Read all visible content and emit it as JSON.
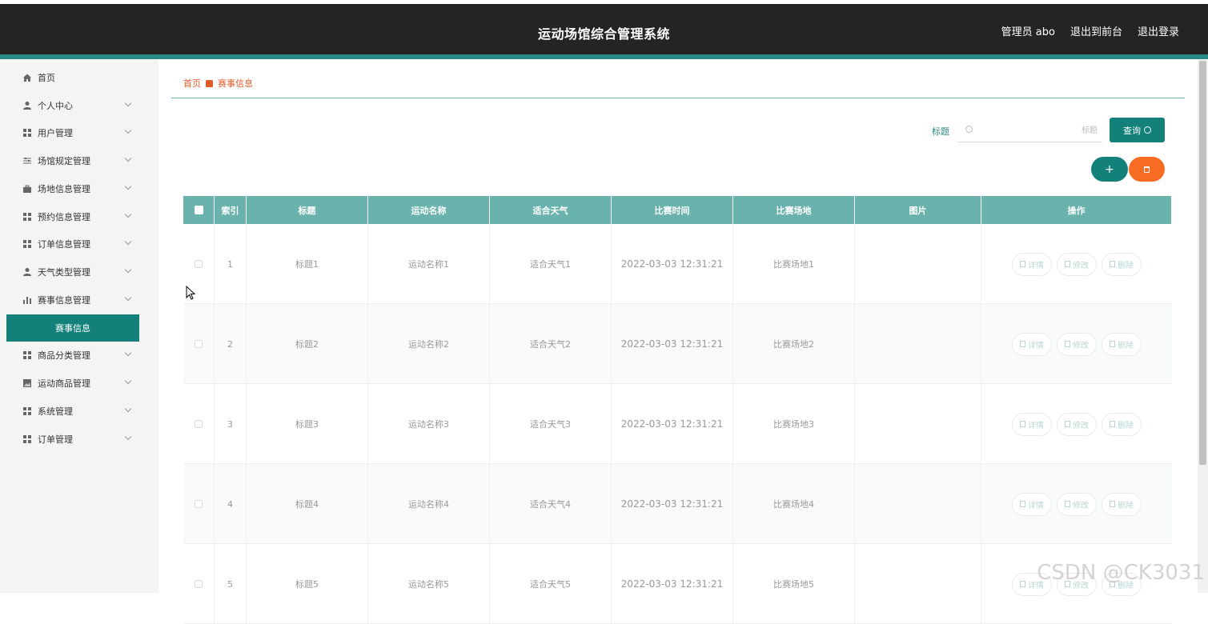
{
  "header": {
    "title": "运动场馆综合管理系统",
    "user": "管理员 abo",
    "to_front": "退出到前台",
    "logout": "退出登录"
  },
  "sidebar": {
    "items": [
      {
        "label": "首页",
        "icon": "home-icon"
      },
      {
        "label": "个人中心",
        "icon": "user-icon"
      },
      {
        "label": "用户管理",
        "icon": "grid-icon"
      },
      {
        "label": "场馆规定管理",
        "icon": "sliders-icon"
      },
      {
        "label": "场地信息管理",
        "icon": "briefcase-icon"
      },
      {
        "label": "预约信息管理",
        "icon": "grid-icon"
      },
      {
        "label": "订单信息管理",
        "icon": "grid-icon"
      },
      {
        "label": "天气类型管理",
        "icon": "user-icon"
      },
      {
        "label": "赛事信息管理",
        "icon": "bar-chart-icon"
      },
      {
        "label": "赛事信息",
        "icon": ""
      },
      {
        "label": "商品分类管理",
        "icon": "grid-icon"
      },
      {
        "label": "运动商品管理",
        "icon": "image-icon"
      },
      {
        "label": "系统管理",
        "icon": "grid-icon"
      },
      {
        "label": "订单管理",
        "icon": "grid-icon"
      }
    ]
  },
  "breadcrumb": {
    "home": "首页",
    "current": "赛事信息"
  },
  "search": {
    "label": "标题",
    "placeholder": "标题",
    "button": "查询"
  },
  "toolbar": {
    "add": "+"
  },
  "table": {
    "columns": [
      "索引",
      "标题",
      "运动名称",
      "适合天气",
      "比赛时间",
      "比赛场地",
      "图片",
      "操作"
    ],
    "rows": [
      {
        "index": "1",
        "title": "标题1",
        "sport": "运动名称1",
        "weather": "适合天气1",
        "time": "2022-03-03 12:31:21",
        "venue": "比赛场地1"
      },
      {
        "index": "2",
        "title": "标题2",
        "sport": "运动名称2",
        "weather": "适合天气2",
        "time": "2022-03-03 12:31:21",
        "venue": "比赛场地2"
      },
      {
        "index": "3",
        "title": "标题3",
        "sport": "运动名称3",
        "weather": "适合天气3",
        "time": "2022-03-03 12:31:21",
        "venue": "比赛场地3"
      },
      {
        "index": "4",
        "title": "标题4",
        "sport": "运动名称4",
        "weather": "适合天气4",
        "time": "2022-03-03 12:31:21",
        "venue": "比赛场地4"
      },
      {
        "index": "5",
        "title": "标题5",
        "sport": "运动名称5",
        "weather": "适合天气5",
        "time": "2022-03-03 12:31:21",
        "venue": "比赛场地5"
      }
    ],
    "actions": {
      "detail": "详情",
      "edit": "修改",
      "delete": "删除"
    }
  },
  "watermark": "CSDN @CK3031",
  "colors": {
    "accent": "#13807a",
    "header_bg": "#242424",
    "danger": "#f56c22",
    "table_header": "#6ab2ac"
  }
}
